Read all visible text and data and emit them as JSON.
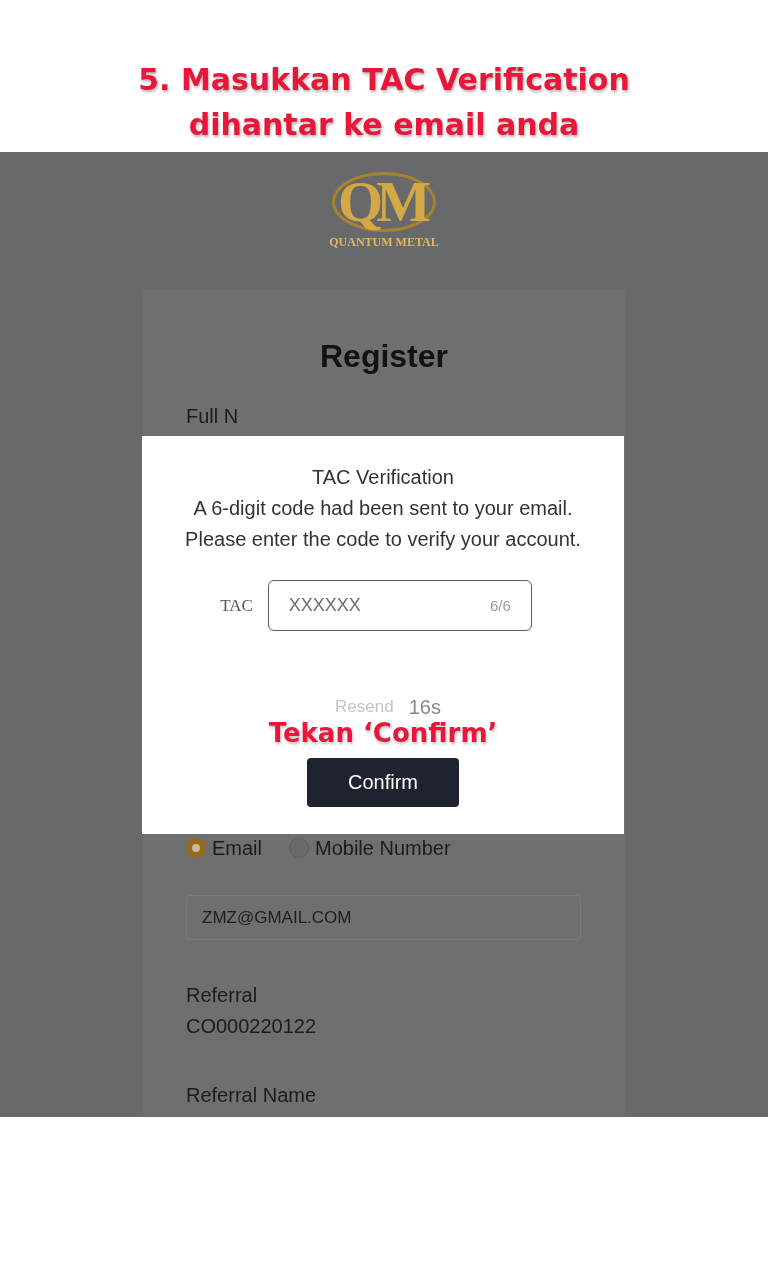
{
  "heading": {
    "lines": [
      "5. Masukkan TAC Verification",
      "dihantar ke email anda"
    ]
  },
  "brand": {
    "monogram": "QM",
    "name": "QUANTUM METAL"
  },
  "register_form": {
    "title": "Register",
    "covered_label": "Full N",
    "contact_options": [
      {
        "label": "Email",
        "selected": true
      },
      {
        "label": "Mobile Number",
        "selected": false
      }
    ],
    "email_field": {
      "value": "ZMZ@GMAIL.COM"
    },
    "referral": {
      "label": "Referral",
      "value": "CO000220122"
    },
    "referral_name": {
      "label": "Referral Name"
    }
  },
  "tac_dialog": {
    "title": "TAC Verification",
    "message_lines": [
      "A 6-digit code had been sent to your email.",
      "Please enter the code to verify your account."
    ],
    "field": {
      "label": "TAC",
      "value": "XXXXXX",
      "counter": "6/6"
    },
    "resend": {
      "label": "Resend",
      "countdown": "16s",
      "disabled": true
    },
    "annotation": "Tekan ‘Confirm’",
    "confirm_button": "Confirm"
  }
}
